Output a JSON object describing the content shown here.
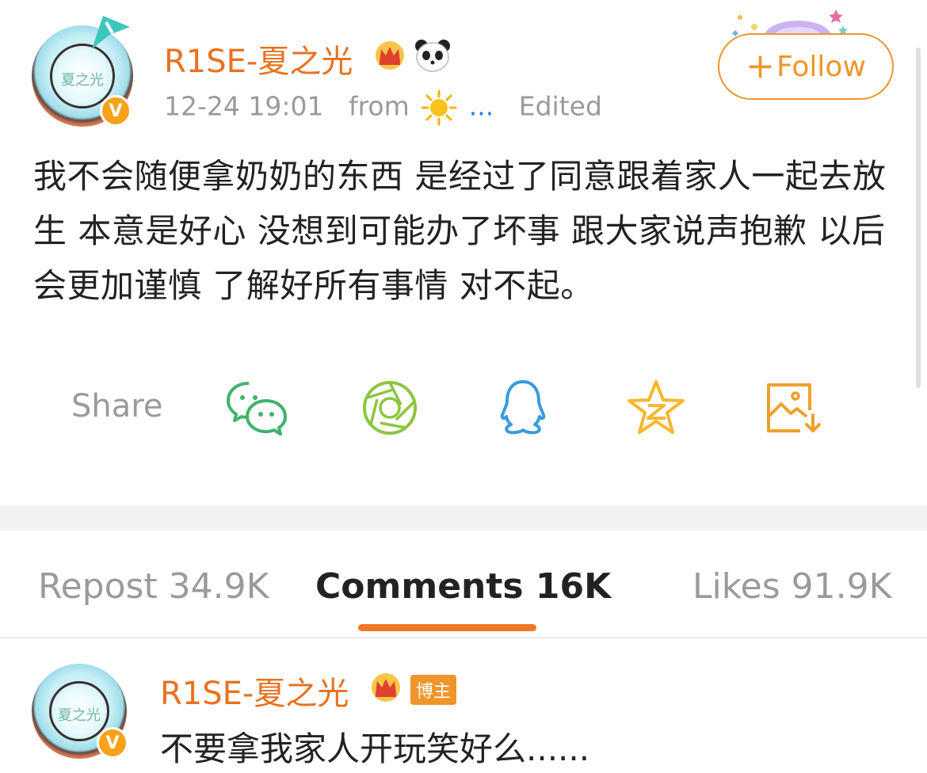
{
  "post": {
    "author": "R1SE-夏之光",
    "time": "12-24 19:01",
    "from_label": "from",
    "source_suffix": "...",
    "edited_label": "Edited",
    "follow_label": "Follow",
    "avatar_text": "夏之光",
    "text": "我不会随便拿奶奶的东西 是经过了同意跟着家人一起去放生 本意是好心 没想到可能办了坏事 跟大家说声抱歉 以后会更加谨慎 了解好所有事情 对不起。"
  },
  "share": {
    "label": "Share",
    "targets": [
      {
        "icon": "wechat-icon",
        "color": "#3fb36b"
      },
      {
        "icon": "moments-icon",
        "color": "#8cc63f"
      },
      {
        "icon": "qq-icon",
        "color": "#3a9bdc"
      },
      {
        "icon": "qzone-icon",
        "color": "#f5b82e"
      },
      {
        "icon": "save-image-icon",
        "color": "#f0a02a"
      }
    ]
  },
  "tabs": {
    "repost": "Repost 34.9K",
    "comments": "Comments 16K",
    "likes": "Likes 91.9K"
  },
  "comment": {
    "author": "R1SE-夏之光",
    "badge": "博主",
    "text": "不要拿我家人开玩笑好么......"
  },
  "colors": {
    "accent": "#e8711f",
    "follow": "#f0952a",
    "tab_active_underline": "#f07a28",
    "muted_text": "#9a9a9a"
  }
}
